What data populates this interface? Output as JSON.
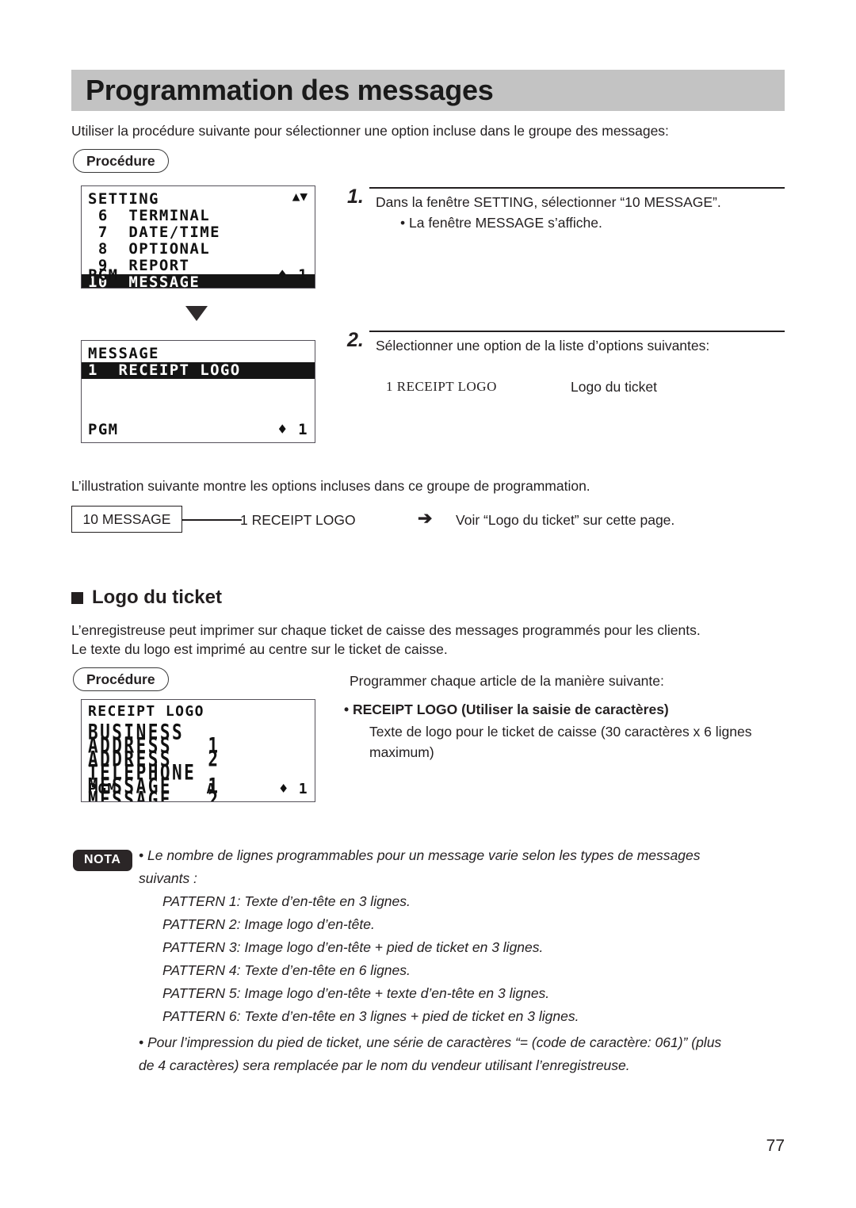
{
  "page": {
    "title": "Programmation des messages",
    "number": "77"
  },
  "intro": {
    "lead": "Utiliser la procédure suivante pour sélectionner une option incluse dans le groupe des messages:",
    "procedure_label": "Procédure"
  },
  "lcd_setting": {
    "header": "SETTING",
    "scroll_icon": "▲▼",
    "rows": [
      " 6  TERMINAL",
      " 7  DATE/TIME",
      " 8  OPTIONAL",
      " 9  REPORT"
    ],
    "highlighted_row": "10  MESSAGE",
    "status_left": "PGM",
    "status_right": "♦ 1"
  },
  "lcd_message": {
    "header": "MESSAGE",
    "highlighted_row": "1  RECEIPT LOGO",
    "status_left": "PGM",
    "status_right": "♦ 1"
  },
  "steps": [
    {
      "number": "1.",
      "text": "Dans la fenêtre SETTING, sélectionner “10 MESSAGE”.",
      "bullet": "• La fenêtre MESSAGE s’affiche."
    },
    {
      "number": "2.",
      "text": "Sélectionner une option de la liste d’options suivantes:",
      "option_code": "1   RECEIPT LOGO",
      "option_desc": "Logo du ticket"
    }
  ],
  "illustration": {
    "lead": "L’illustration suivante montre les options incluses dans ce groupe de programmation.",
    "box_label": "10 MESSAGE",
    "item_label": "1   RECEIPT LOGO",
    "arrow_icon": "➔",
    "reference": "Voir “Logo du ticket” sur cette page."
  },
  "logo_section": {
    "heading": "Logo du ticket",
    "para_line1": "L’enregistreuse peut imprimer sur chaque ticket de caisse des messages programmés pour les clients.",
    "para_line2": "Le texte du logo est imprimé au centre sur le ticket de caisse.",
    "procedure_label": "Procédure",
    "instruction": "Programmer chaque article de la manière suivante:",
    "item_title": "• RECEIPT LOGO (Utiliser la saisie de caractères)",
    "item_desc_line1": "Texte de logo pour le ticket de caisse (30 caractères x 6 lignes",
    "item_desc_line2": "maximum)"
  },
  "lcd_receipt_logo": {
    "header": "RECEIPT LOGO",
    "lines": [
      "BUSINESS",
      "ADDRESS   1",
      "ADDRESS   2",
      "TELEPHONE",
      "MESSAGE   1",
      "MESSAGE   2"
    ],
    "status_left": "PGM",
    "status_mid": "A",
    "status_right": "♦ 1"
  },
  "nota": {
    "badge": "NOTA",
    "bullet1_line1": "• Le nombre de lignes programmables pour un message varie selon les types de messages",
    "bullet1_line2": "suivants :",
    "patterns": [
      "PATTERN 1: Texte d’en-tête en 3 lignes.",
      "PATTERN 2: Image logo d’en-tête.",
      "PATTERN 3: Image logo d’en-tête + pied de ticket en 3 lignes.",
      "PATTERN 4: Texte d’en-tête en 6 lignes.",
      "PATTERN 5: Image logo d’en-tête + texte d’en-tête en 3 lignes.",
      "PATTERN 6: Texte d’en-tête en 3 lignes + pied de ticket en 3 lignes."
    ],
    "bullet2_line1": "• Pour l’impression du pied de ticket, une série de caractères “= (code de caractère: 061)” (plus",
    "bullet2_line2": "de 4 caractères) sera remplacée par le nom du vendeur utilisant l’enregistreuse."
  },
  "colors": {
    "title_bar_bg": "#c3c3c3",
    "ink": "#231f20",
    "badge_bg": "#2b2627"
  }
}
